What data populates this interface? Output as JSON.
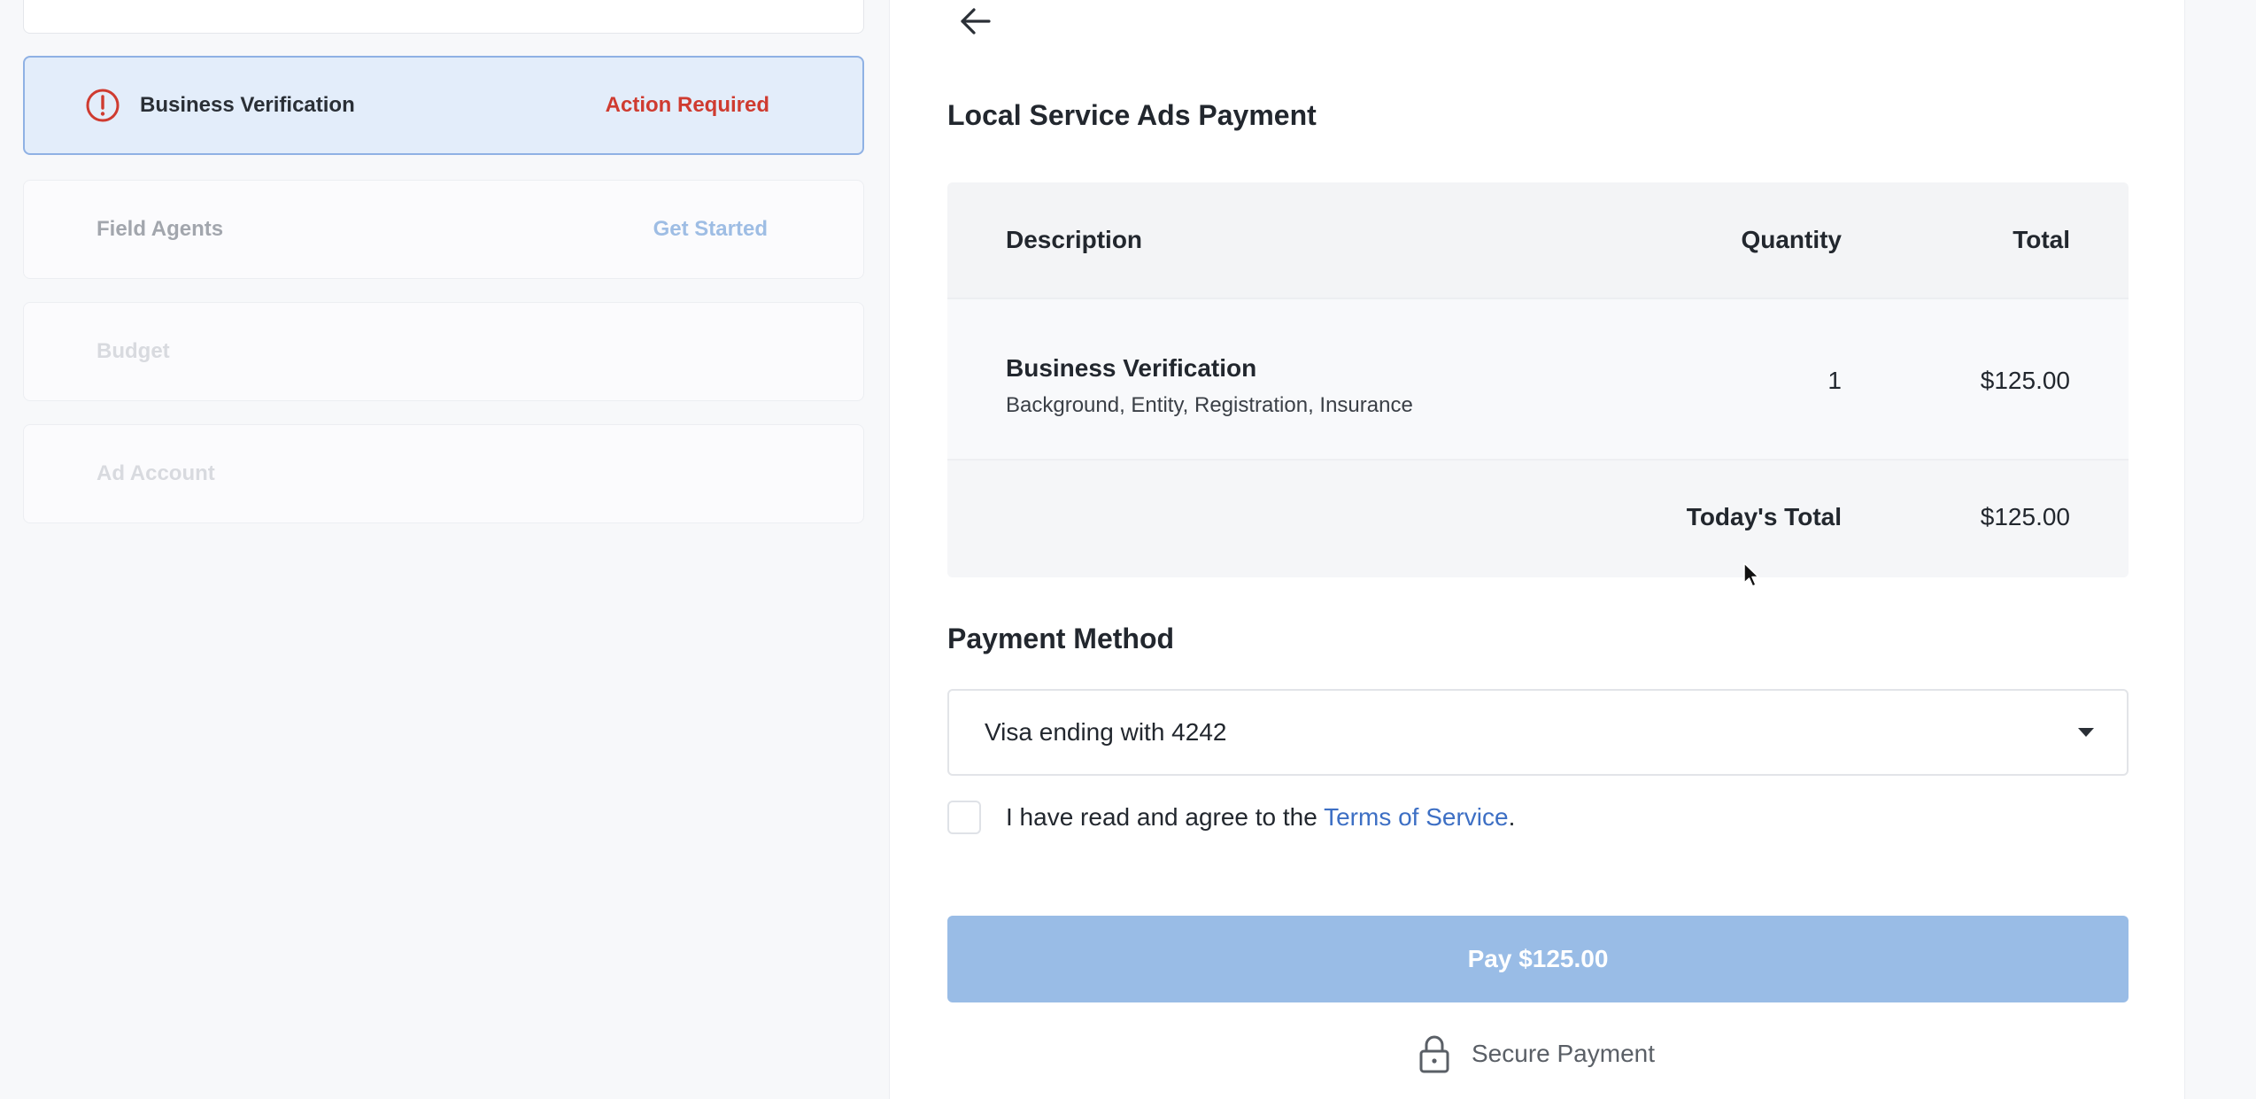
{
  "sidebar": {
    "steps": [
      {
        "label": "Business Verification",
        "status": "Action Required",
        "icon": "alert-circle-icon"
      },
      {
        "label": "Field Agents",
        "status": "Get Started"
      },
      {
        "label": "Budget",
        "status": ""
      },
      {
        "label": "Ad Account",
        "status": ""
      }
    ]
  },
  "main": {
    "back_icon": "arrow-left-icon",
    "title": "Local Service Ads Payment",
    "invoice": {
      "headers": {
        "description": "Description",
        "quantity": "Quantity",
        "total": "Total"
      },
      "items": [
        {
          "name": "Business Verification",
          "details": "Background, Entity, Registration, Insurance",
          "quantity": "1",
          "total": "$125.00"
        }
      ],
      "total_label": "Today's Total",
      "total_value": "$125.00"
    },
    "payment": {
      "section_title": "Payment Method",
      "selected_method": "Visa ending with 4242",
      "agree_prefix": "I have read and agree to the ",
      "terms_link": "Terms of Service",
      "agree_suffix": ".",
      "pay_button": "Pay $125.00",
      "secure_label": "Secure Payment"
    }
  },
  "colors": {
    "accent_blue": "#3d6fc4",
    "pay_button_disabled": "#99bce6",
    "action_required_red": "#cf3b30",
    "active_step_bg": "#e3edfa"
  }
}
